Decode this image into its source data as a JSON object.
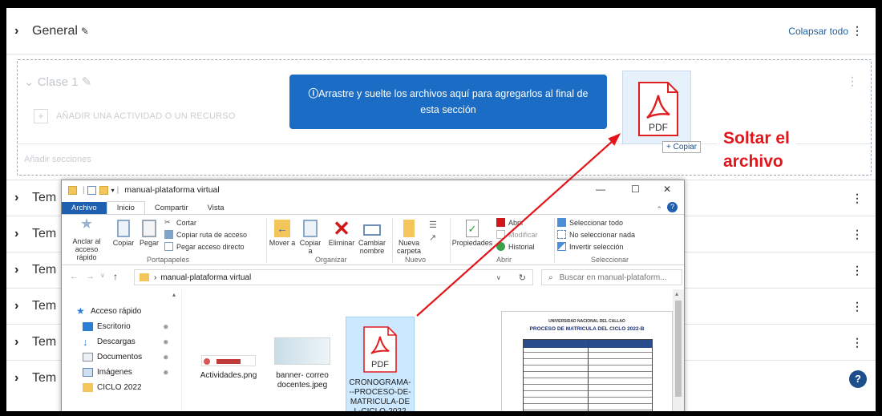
{
  "course": {
    "general_title": "General",
    "collapse_all": "Colapsar todo",
    "section_clase": "Clase 1",
    "add_activity": "AÑADIR UNA ACTIVIDAD O UN RECURSO",
    "add_sections": "Añadir secciones",
    "drop_message": "Arrastre y suelte los archivos aquí para agregarlos al final de esta sección",
    "copy_badge": "+ Copiar",
    "tema_label": "Tem",
    "help": "?"
  },
  "annotation": {
    "line1": "Soltar el",
    "line2": "archivo",
    "color": "#e3151a"
  },
  "explorer": {
    "title": "manual-plataforma virtual",
    "tabs": [
      "Archivo",
      "Inicio",
      "Compartir",
      "Vista"
    ],
    "ribbon": {
      "pin_label": "Anclar al acceso rápido",
      "copy": "Copiar",
      "paste": "Pegar",
      "cut": "Cortar",
      "copy_path": "Copiar ruta de acceso",
      "paste_shortcut": "Pegar acceso directo",
      "group_clipboard": "Portapapeles",
      "move_to": "Mover a",
      "copy_to": "Copiar a",
      "delete": "Eliminar",
      "rename": "Cambiar nombre",
      "group_organize": "Organizar",
      "new_folder": "Nueva carpeta",
      "group_new": "Nuevo",
      "properties": "Propiedades",
      "open": "Abrir",
      "modify": "Modificar",
      "history": "Historial",
      "group_open": "Abrir",
      "select_all": "Seleccionar todo",
      "select_none": "No seleccionar nada",
      "invert": "Invertir selección",
      "group_select": "Seleccionar"
    },
    "address": "manual-plataforma virtual",
    "search_placeholder": "Buscar en manual-plataform...",
    "nav": [
      "Acceso rápido",
      "Escritorio",
      "Descargas",
      "Documentos",
      "Imágenes",
      "CICLO 2022"
    ],
    "files": [
      {
        "name": "Actividades.png"
      },
      {
        "name": "banner- correo docentes.jpeg"
      },
      {
        "name": "CRONOGRAMA---PROCESO-DE-MATRICULA-DEL-CICLO-2022"
      }
    ],
    "preview": {
      "line1": "UNIVERSIDAD NACIONAL DEL CALLAO",
      "line2": "PROCESO DE MATRICULA DEL CICLO 2022-B"
    },
    "pdf_text": "PDF"
  },
  "colors": {
    "moodle_blue": "#1b6cc4",
    "pdf_red": "#e02020",
    "explorer_blue": "#1f5fb0"
  }
}
